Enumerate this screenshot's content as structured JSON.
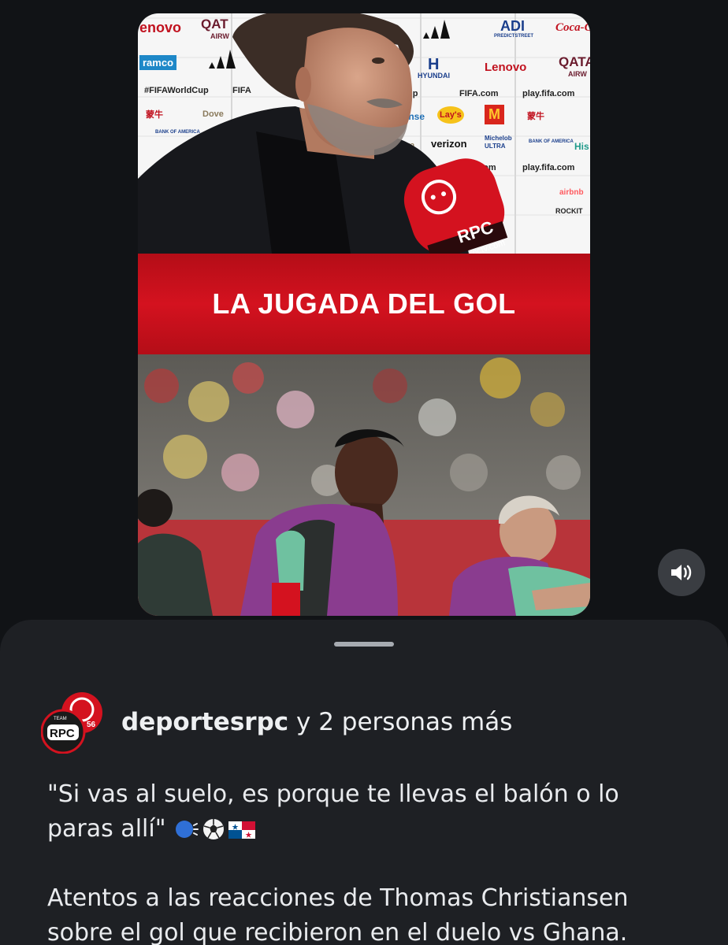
{
  "video": {
    "title_text": "LA JUGADA DEL GOL",
    "mic_label": "RPC",
    "mic_url": "rpctv.com",
    "sponsors": {
      "lenovo_cut": "enovo",
      "qatar_cut": "QAT",
      "qatar_airways_cut": "AIRW",
      "ramco_cut": "ramco",
      "fifa_hashtag": "#FIFAWorldCup",
      "fifa_hashtag_cut": "rldCup",
      "fifa_cut": "FIFA",
      "adi": "ADI",
      "adi_sub": "PREDICTSTREET",
      "cocacola": "Coca-Cola",
      "hyundai": "HYUNDAI",
      "lenovo": "Lenovo",
      "qatar": "QATA",
      "qatar_airways": "AIRW",
      "hisense": "Hisense",
      "lays": "Lay's",
      "fifa_com": "FIFA.com",
      "play_fifa": "play.fifa.com",
      "dove": "Dove",
      "verizon": "verizon",
      "michelob": "Michelob ULTRA",
      "hisense_cut": "His",
      "com_cut": "com",
      "airbnb": "airbnb",
      "rocket": "ROCKIT",
      "boa": "BANK OF AMERICA",
      "mengniu": "蒙牛"
    }
  },
  "controls": {
    "volume_icon": "speaker-icon"
  },
  "post": {
    "author": "deportesrpc",
    "collaborators": "y 2 personas más",
    "caption_line1": "\"Si vas al suelo, es porque te llevas el balón o lo",
    "caption_line2": "paras allí\"",
    "caption_emojis": [
      "speaking-head",
      "soccer-ball",
      "flag-panama"
    ],
    "caption_para2": "Atentos a las reacciones de Thomas Christiansen sobre el gol que recibieron en el duelo vs Ghana.",
    "avatar_label": "RPC",
    "avatar_badge": "56",
    "avatar_top": "TEAM"
  },
  "colors": {
    "brand_red": "#d4121f",
    "background": "#111316",
    "sheet": "#1e2024"
  }
}
